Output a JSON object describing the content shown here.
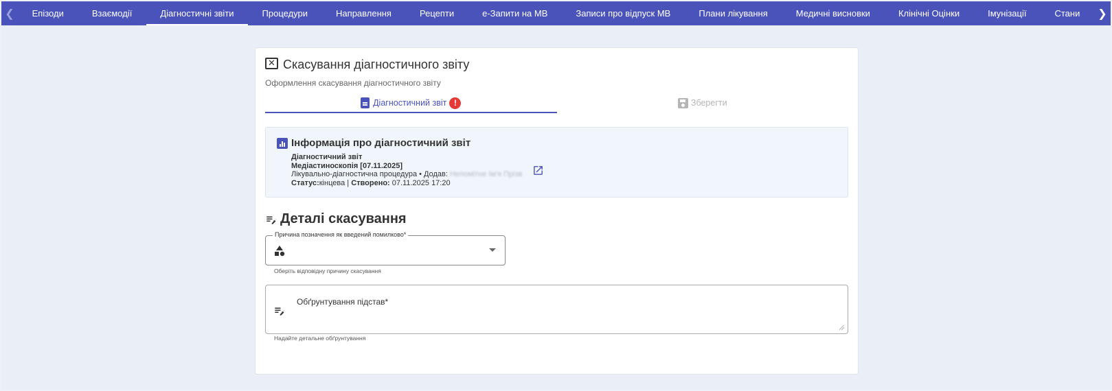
{
  "nav": {
    "prev_icon": "chevron-left-icon",
    "next_icon": "chevron-right-icon",
    "tabs": [
      {
        "label": "Епізоди"
      },
      {
        "label": "Взаємодії"
      },
      {
        "label": "Діагностичні звіти",
        "active": true
      },
      {
        "label": "Процедури"
      },
      {
        "label": "Направлення"
      },
      {
        "label": "Рецепти"
      },
      {
        "label": "е-Запити на МВ"
      },
      {
        "label": "Записи про відпуск МВ"
      },
      {
        "label": "Плани лікування"
      },
      {
        "label": "Медичні висновки"
      },
      {
        "label": "Клінічні Оцінки"
      },
      {
        "label": "Імунізації"
      },
      {
        "label": "Стани"
      }
    ]
  },
  "card": {
    "title": "Скасування діагностичного звіту",
    "subtitle": "Оформлення скасування діагностичного звіту",
    "steps": {
      "report": "Діагностичний звіт",
      "error_badge": "!",
      "save": "Зберегти"
    },
    "info": {
      "title": "Інформація про діагностичний звіт",
      "type_label": "Діагностичний звіт",
      "name": "Медіастиноскопія [07.11.2025]",
      "category_prefix": "Лікувально-діагностична процедура • Додав: ",
      "added_by": "Непомітне Ім'я Прізв",
      "status_label": "Статус:",
      "status_value": "кінцева",
      "separator": " | ",
      "created_label": "Створено:",
      "created_value": " 07.11.2025 17:20"
    },
    "details": {
      "title": "Деталі скасування",
      "reason_label": "Причина позначення як введений помилково*",
      "reason_value": "",
      "reason_helper": "Оберіть відповідну причину скасування",
      "justification_placeholder": "Обґрунтування підстав*",
      "justification_helper": "Надайте детальне обґрунтування"
    }
  },
  "colors": {
    "primary": "#4a53b9",
    "error": "#e53935",
    "background": "#eaeff7"
  }
}
